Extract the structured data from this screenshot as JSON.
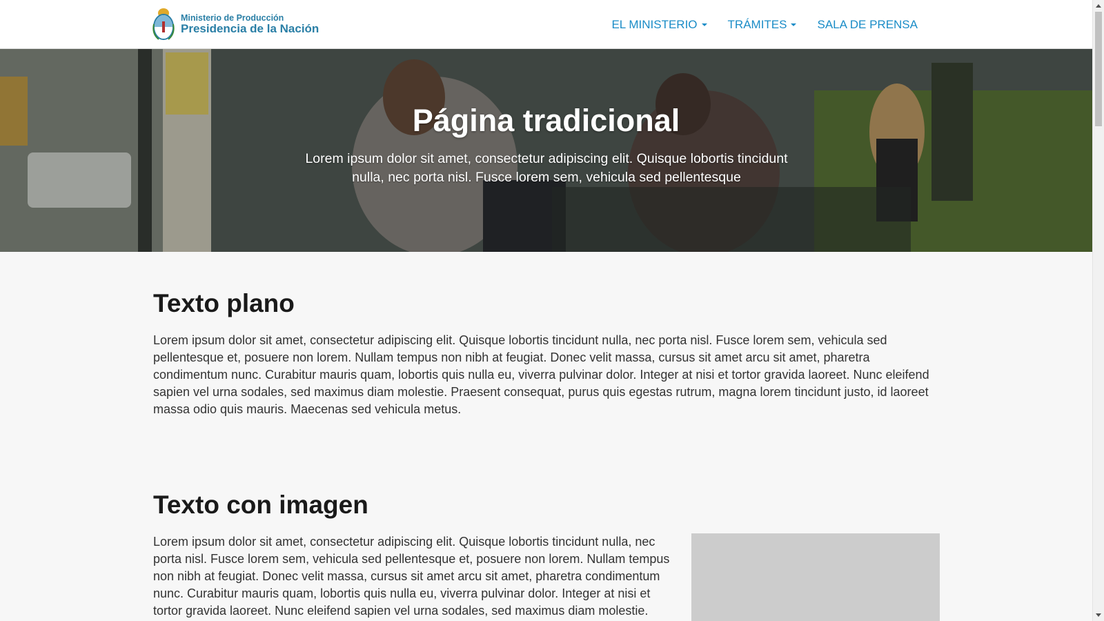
{
  "navbar": {
    "brand_line1": "Ministerio de Producción",
    "brand_line2": "Presidencia de la Nación",
    "brand_icon": "argentina-coat-of-arms",
    "items": [
      {
        "label": "EL MINISTERIO",
        "has_dropdown": true
      },
      {
        "label": "TRÁMITES",
        "has_dropdown": true
      },
      {
        "label": "SALA DE PRENSA",
        "has_dropdown": false
      }
    ],
    "link_color": "#1a8cc7"
  },
  "hero": {
    "title": "Página tradicional",
    "subtitle": "Lorem ipsum dolor sit amet, consectetur adipiscing elit. Quisque lobortis tincidunt nulla, nec porta nisl. Fusce lorem sem, vehicula sed pellentesque"
  },
  "sections": [
    {
      "title": "Texto plano",
      "text": "Lorem ipsum dolor sit amet, consectetur adipiscing elit. Quisque lobortis tincidunt nulla, nec porta nisl. Fusce lorem sem, vehicula sed pellentesque et, posuere non lorem. Nullam tempus non nibh at feugiat. Donec velit massa, cursus sit amet arcu sit amet, pharetra condimentum nunc. Curabitur mauris quam, lobortis quis nulla eu, viverra pulvinar dolor. Integer at nisi et tortor gravida laoreet. Nunc eleifend sapien vel urna sodales, sed maximus diam molestie. Praesent consequat, purus quis egestas rutrum, magna lorem tincidunt justo, id laoreet massa odio quis mauris. Maecenas sed vehicula metus."
    },
    {
      "title": "Texto con imagen",
      "text": "Lorem ipsum dolor sit amet, consectetur adipiscing elit. Quisque lobortis tincidunt nulla, nec porta nisl. Fusce lorem sem, vehicula sed pellentesque et, posuere non lorem. Nullam tempus non nibh at feugiat. Donec velit massa, cursus sit amet arcu sit amet, pharetra condimentum nunc. Curabitur mauris quam, lobortis quis nulla eu, viverra pulvinar dolor. Integer at nisi et tortor gravida laoreet. Nunc eleifend sapien vel urna sodales, sed maximus diam molestie."
    }
  ]
}
